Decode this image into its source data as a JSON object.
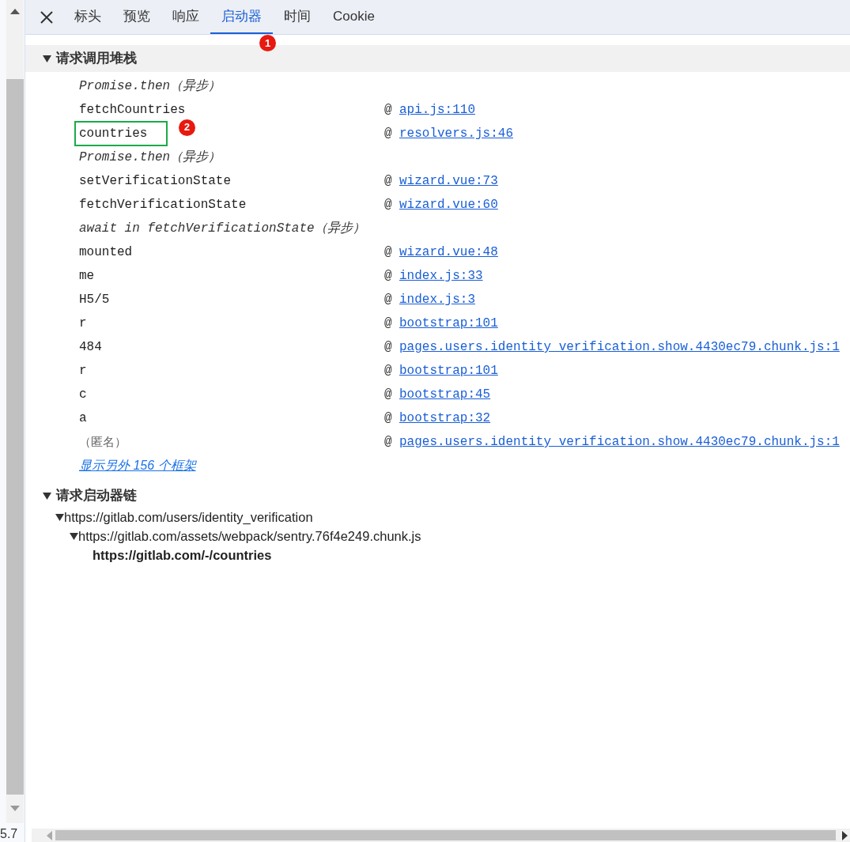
{
  "side_panel": {
    "value": "5.7"
  },
  "tabs": [
    {
      "label": "标头",
      "selected": false
    },
    {
      "label": "预览",
      "selected": false
    },
    {
      "label": "响应",
      "selected": false
    },
    {
      "label": "启动器",
      "selected": true,
      "annotation": "1"
    },
    {
      "label": "时间",
      "selected": false
    },
    {
      "label": "Cookie",
      "selected": false
    }
  ],
  "call_stack": {
    "title": "请求调用堆栈",
    "expanded": true,
    "frames": [
      {
        "kind": "async",
        "text": "Promise.then（异步）"
      },
      {
        "kind": "call",
        "function": "fetchCountries",
        "at": "@",
        "location": "api.js:110",
        "highlighted": false
      },
      {
        "kind": "call",
        "function": "countries",
        "at": "@",
        "location": "resolvers.js:46",
        "highlighted": true,
        "annotation": "2"
      },
      {
        "kind": "async",
        "text": "Promise.then（异步）"
      },
      {
        "kind": "call",
        "function": "setVerificationState",
        "at": "@",
        "location": "wizard.vue:73",
        "highlighted": false
      },
      {
        "kind": "call",
        "function": "fetchVerificationState",
        "at": "@",
        "location": "wizard.vue:60",
        "highlighted": false
      },
      {
        "kind": "async",
        "text": "await in fetchVerificationState（异步）"
      },
      {
        "kind": "call",
        "function": "mounted",
        "at": "@",
        "location": "wizard.vue:48",
        "highlighted": false
      },
      {
        "kind": "call",
        "function": "me",
        "at": "@",
        "location": "index.js:33",
        "highlighted": false
      },
      {
        "kind": "call",
        "function": "H5/5",
        "at": "@",
        "location": "index.js:3",
        "highlighted": false
      },
      {
        "kind": "call",
        "function": "r",
        "at": "@",
        "location": "bootstrap:101",
        "highlighted": false
      },
      {
        "kind": "call",
        "function": "484",
        "at": "@",
        "location": "pages.users.identity_verification.show.4430ec79.chunk.js:1",
        "highlighted": false
      },
      {
        "kind": "call",
        "function": "r",
        "at": "@",
        "location": "bootstrap:101",
        "highlighted": false
      },
      {
        "kind": "call",
        "function": "c",
        "at": "@",
        "location": "bootstrap:45",
        "highlighted": false
      },
      {
        "kind": "call",
        "function": "a",
        "at": "@",
        "location": "bootstrap:32",
        "highlighted": false
      },
      {
        "kind": "anonymous",
        "function": "（匿名）",
        "at": "@",
        "location": "pages.users.identity_verification.show.4430ec79.chunk.js:1",
        "highlighted": false
      }
    ],
    "show_more": "显示另外 156 个框架"
  },
  "initiator_chain": {
    "title": "请求启动器链",
    "expanded": true,
    "items": [
      {
        "url": "https://gitlab.com/users/identity_verification",
        "current": false,
        "expanded": true,
        "children": [
          {
            "url": "https://gitlab.com/assets/webpack/sentry.76f4e249.chunk.js",
            "current": false,
            "expanded": true,
            "children": [
              {
                "url": "https://gitlab.com/-/countries",
                "current": true
              }
            ]
          }
        ]
      }
    ]
  }
}
